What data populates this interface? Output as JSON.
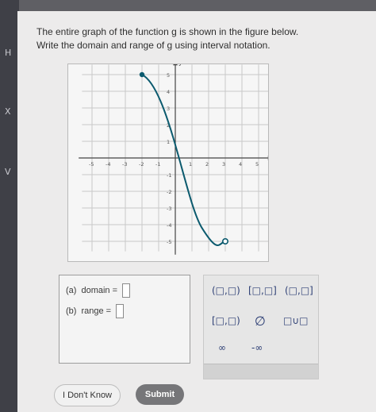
{
  "sidebar": {
    "glyphs": [
      "H",
      "X",
      "V"
    ]
  },
  "question": {
    "line1": "The entire graph of the function g is shown in the figure below.",
    "line2": "Write the domain and range of g using interval notation."
  },
  "graph": {
    "x_axis_label": "x",
    "y_axis_label": "y",
    "x_ticks": [
      "-5",
      "-4",
      "-3",
      "-2",
      "-1",
      "1",
      "2",
      "3",
      "4",
      "5"
    ],
    "y_ticks": [
      "5",
      "4",
      "3",
      "2",
      "1",
      "-1",
      "-2",
      "-3",
      "-4",
      "-5"
    ],
    "endpoint_closed": [
      -2,
      5
    ],
    "endpoint_open": [
      3,
      -5
    ]
  },
  "answers": {
    "domain_part": "(a)",
    "domain_label": "domain =",
    "range_part": "(b)",
    "range_label": "range ="
  },
  "keypad": {
    "k1": "(□,□)",
    "k2": "[□,□]",
    "k3": "(□,□]",
    "k4": "[□,□)",
    "k5": "∅",
    "k6": "□∪□",
    "k7": "∞",
    "k8": "-∞"
  },
  "buttons": {
    "dont_know": "I Don't Know",
    "submit": "Submit"
  },
  "colors": {
    "curve": "#0b5a6e",
    "submit_bg": "#767679"
  }
}
